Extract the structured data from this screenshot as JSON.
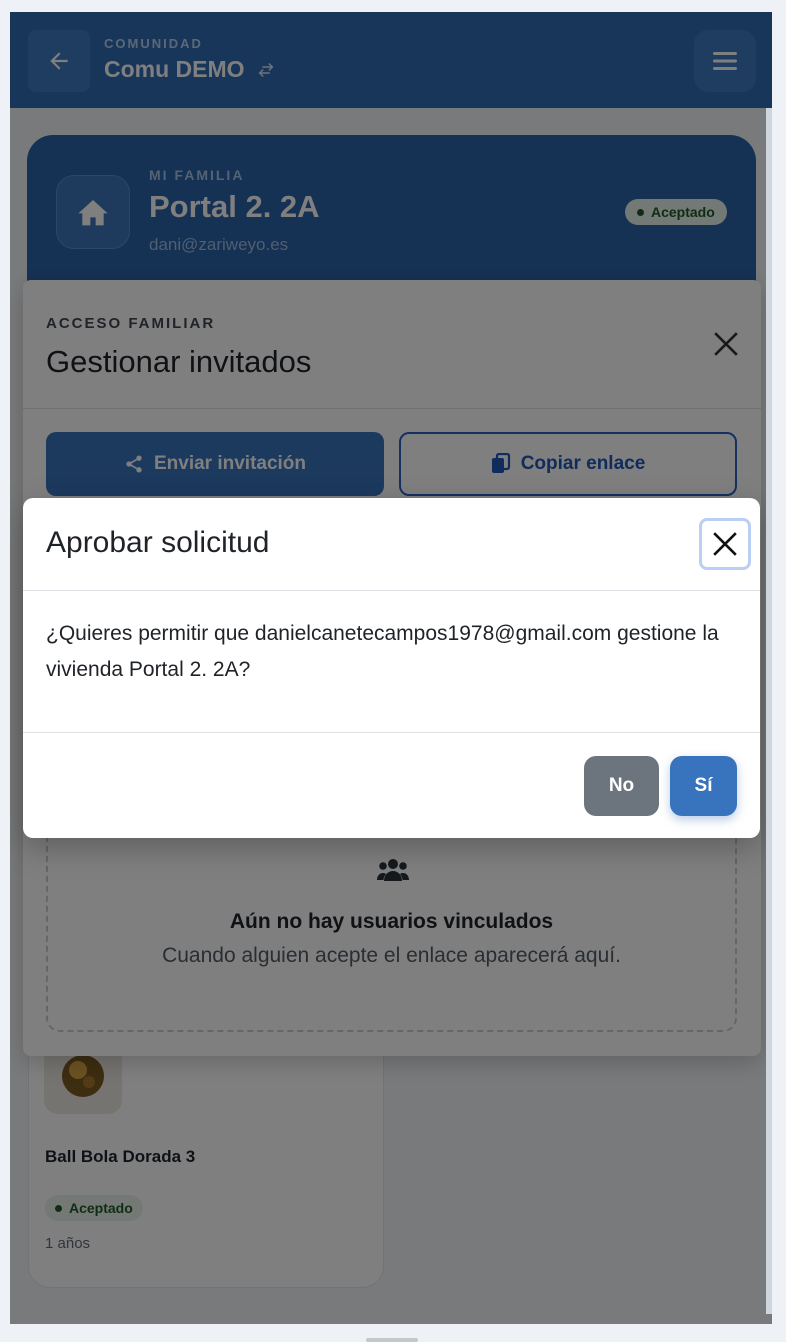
{
  "header": {
    "eyebrow": "COMUNIDAD",
    "title": "Comu DEMO",
    "back_icon": "arrow-left-icon",
    "switch_icon": "swap-icon",
    "menu_icon": "hamburger-menu-icon"
  },
  "family_card": {
    "eyebrow": "MI FAMILIA",
    "title": "Portal 2. 2A",
    "email": "dani@zariweyo.es",
    "status": "Aceptado",
    "icon": "home-icon"
  },
  "item_card": {
    "title": "Ball Bola Dorada 3",
    "status": "Aceptado",
    "age": "1 años"
  },
  "manage_modal": {
    "eyebrow": "ACCESO FAMILIAR",
    "title": "Gestionar invitados",
    "invite_label": "Enviar invitación",
    "copy_label": "Copiar enlace",
    "empty_title": "Aún no hay usuarios vinculados",
    "empty_text": "Cuando alguien acepte el enlace aparecerá aquí."
  },
  "approve_dialog": {
    "title": "Aprobar solicitud",
    "message": "¿Quieres permitir que danielcanetecampos1978@gmail.com gestione la vivienda Portal 2. 2A?",
    "no_label": "No",
    "yes_label": "Sí"
  },
  "colors": {
    "primary": "#3873bd",
    "header": "#2f6db5",
    "success": "#1f5a2c",
    "secondary": "#6c757d"
  }
}
